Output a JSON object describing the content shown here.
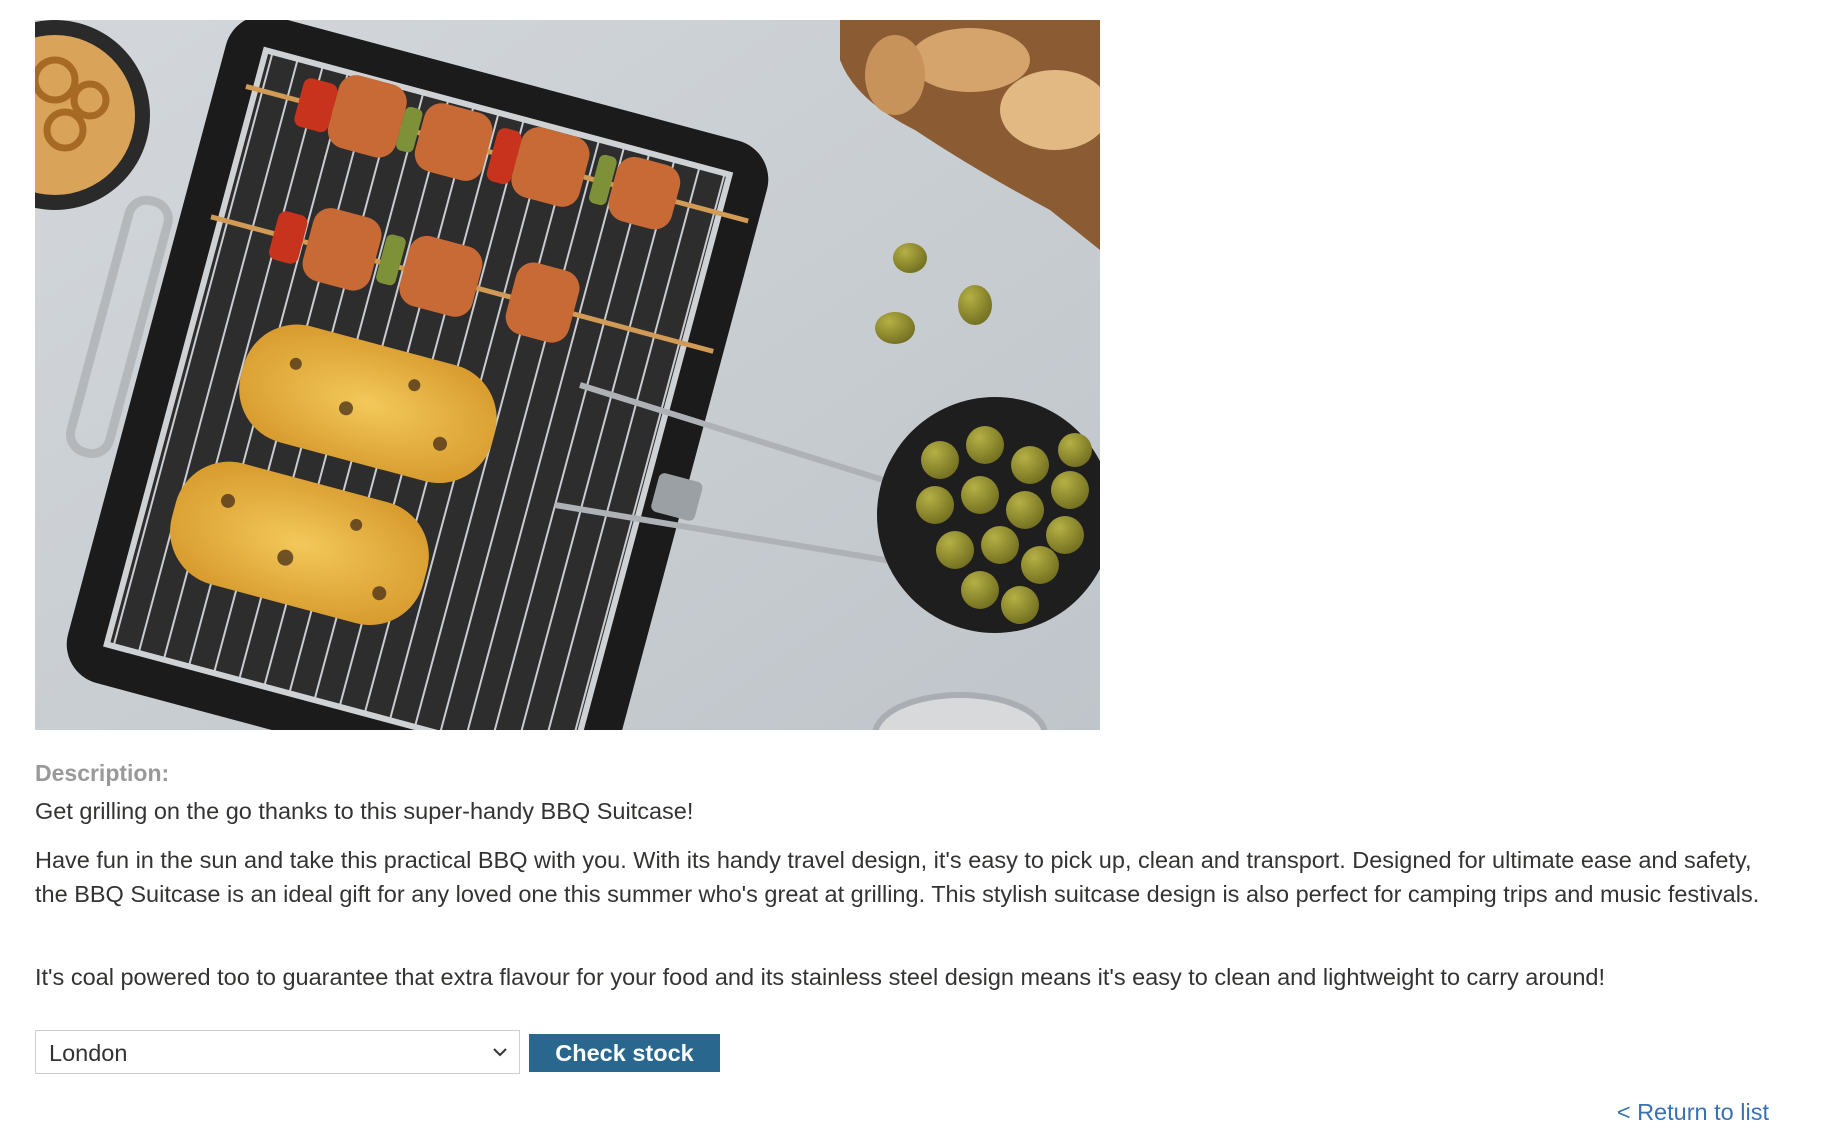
{
  "product": {
    "image_alt": "BBQ Suitcase product photo",
    "description_heading": "Description:",
    "paragraphs": [
      "Get grilling on the go thanks to this super-handy BBQ Suitcase!",
      "Have fun in the sun and take this practical BBQ with you. With its handy travel design, it's easy to pick up, clean and transport. Designed for ultimate ease and safety, the BBQ Suitcase is an ideal gift for any loved one this summer who's great at grilling. This stylish suitcase design is also perfect for camping trips and music festivals.",
      "It's coal powered too to guarantee that extra flavour for your food and its stainless steel design means it's easy to clean and lightweight to carry around!"
    ]
  },
  "stock_check": {
    "selected_store": "London",
    "button_label": "Check stock"
  },
  "navigation": {
    "return_link": "< Return to list"
  },
  "colors": {
    "button_bg": "#29678e",
    "link": "#3971b3",
    "heading_muted": "#999999",
    "text": "#333332"
  }
}
